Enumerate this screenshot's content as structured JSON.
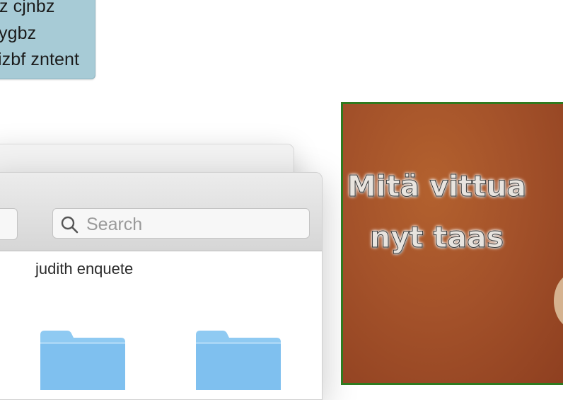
{
  "sticky_note": {
    "lines": [
      "z cjnbz",
      "ygbz",
      "izbf zntent"
    ]
  },
  "finder": {
    "search": {
      "placeholder": "Search"
    },
    "item_label": "judith enquete"
  },
  "image_card": {
    "text_line1": "Mitä vittua",
    "text_line2": "nyt taas"
  },
  "colors": {
    "sticky_bg": "#a7cbd6",
    "folder_blue": "#8fcaf2",
    "image_border": "#2f7a1f",
    "image_bg": "#a4522a"
  },
  "icons": [
    "search-icon",
    "folder-icon"
  ]
}
